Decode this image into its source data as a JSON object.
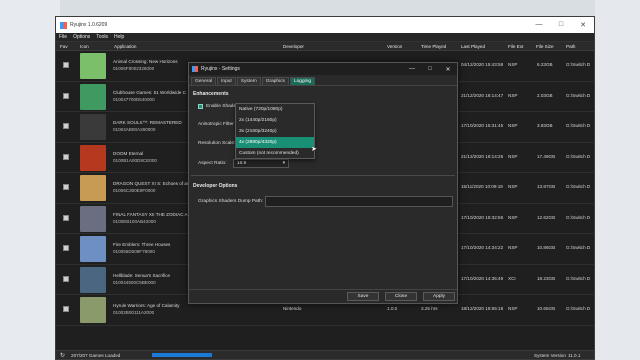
{
  "window": {
    "title": "Ryujinx 1.0.6209"
  },
  "menu": [
    "File",
    "Options",
    "Tools",
    "Help"
  ],
  "columns": [
    "Fav",
    "Icon",
    "Application",
    "Developer",
    "Version",
    "Time Played",
    "Last Played",
    "File Ext",
    "File Size",
    "Path"
  ],
  "games": [
    {
      "name": "Animal Crossing: New Horizons",
      "id": "01006F8002326000",
      "developer": "",
      "version": "",
      "time": "",
      "last": "04/12/2020 15:43:58",
      "ext": "NSP",
      "size": "6.23GB",
      "path": "G:\\Switch D",
      "thumb": "#7bbf6a"
    },
    {
      "name": "Clubhouse Games: 51 Worldwide C",
      "id": "010047700D540000",
      "developer": "",
      "version": "",
      "time": "",
      "last": "21/12/2020 18:14:47",
      "ext": "NSP",
      "size": "2.03GB",
      "path": "G:\\Switch D",
      "thumb": "#3f9a62"
    },
    {
      "name": "DARK SOULS™: REMASTERED",
      "id": "01004AB00A260000",
      "developer": "",
      "version": "",
      "time": "",
      "last": "17/10/2020 15:31:45",
      "ext": "NSP",
      "size": "3.83GB",
      "path": "G:\\Switch D",
      "thumb": "#3a3a3a"
    },
    {
      "name": "DOOM Eternal",
      "id": "0100B1A00D8CE000",
      "developer": "",
      "version": "",
      "time": "",
      "last": "21/12/2020 18:14:25",
      "ext": "NSP",
      "size": "17.49GB",
      "path": "G:\\Switch D",
      "thumb": "#b5381f"
    },
    {
      "name": "DRAGON QUEST XI S: Echoes of an",
      "id": "01006C300E9F0000",
      "developer": "",
      "version": "",
      "time": "",
      "last": "15/11/2020 10:09:19",
      "ext": "NSP",
      "size": "13.87GB",
      "path": "G:\\Switch D",
      "thumb": "#c79b54"
    },
    {
      "name": "FINAL FANTASY XII THE ZODIAC A",
      "id": "0100EB100AB42000",
      "developer": "",
      "version": "",
      "time": "",
      "last": "17/10/2020 15:32:56",
      "ext": "NSP",
      "size": "12.62GB",
      "path": "G:\\Switch D",
      "thumb": "#6b6e80"
    },
    {
      "name": "Fire Emblem: Three Houses",
      "id": "010055D009F78000",
      "developer": "",
      "version": "",
      "time": "",
      "last": "17/10/2020 14:34:22",
      "ext": "NSP",
      "size": "10.86GB",
      "path": "G:\\Switch D",
      "thumb": "#6e8fc2"
    },
    {
      "name": "Hellblade: Senua's Sacrifice",
      "id": "010044500C5BE000",
      "developer": "",
      "version": "",
      "time": "",
      "last": "17/10/2020 14:35:49",
      "ext": "XCI",
      "size": "18.23GB",
      "path": "G:\\Switch D",
      "thumb": "#4a6680"
    },
    {
      "name": "Hyrule Warriors: Age of Calamity",
      "id": "01002B00111A2000",
      "developer": "Nintendo",
      "version": "1.0.0",
      "time": "3.25 hrs",
      "last": "18/12/2020 18:55:18",
      "ext": "NSP",
      "size": "10.65GB",
      "path": "G:\\Switch D",
      "thumb": "#8a9a6a"
    }
  ],
  "status": {
    "refresh_icon": "refresh-icon",
    "loaded": "207/207 Games Loaded",
    "system_version_label": "System Version",
    "system_version": "11.0.1",
    "load_progress": 1.0
  },
  "settings": {
    "title": "Ryujinx - Settings",
    "tabs": [
      "General",
      "Input",
      "System",
      "Graphics",
      "Logging"
    ],
    "active_tab": "Graphics",
    "enhancements_title": "Enhancements",
    "enable_shader_label": "Enable Shader",
    "anisotropic_label": "Anisotropic Filter",
    "resolution_label": "Resolution Scale:",
    "aspect_label": "Aspect Ratio:",
    "aspect_value": "16:9",
    "dev_title": "Developer Options",
    "dump_path_label": "Graphics Shaders Dump Path:",
    "dump_path_value": "",
    "resolution_options": [
      "Native (720p/1080p)",
      "2x (1440p/2160p)",
      "3x (2160p/3240p)",
      "4x (2880p/4320p)",
      "Custom (not recommended)"
    ],
    "highlighted_option": 3,
    "buttons": {
      "save": "Save",
      "close": "Close",
      "apply": "Apply"
    }
  },
  "colors": {
    "accent": "#198f75",
    "progress": "#1a7bd6",
    "background": "#1f1f1f"
  }
}
